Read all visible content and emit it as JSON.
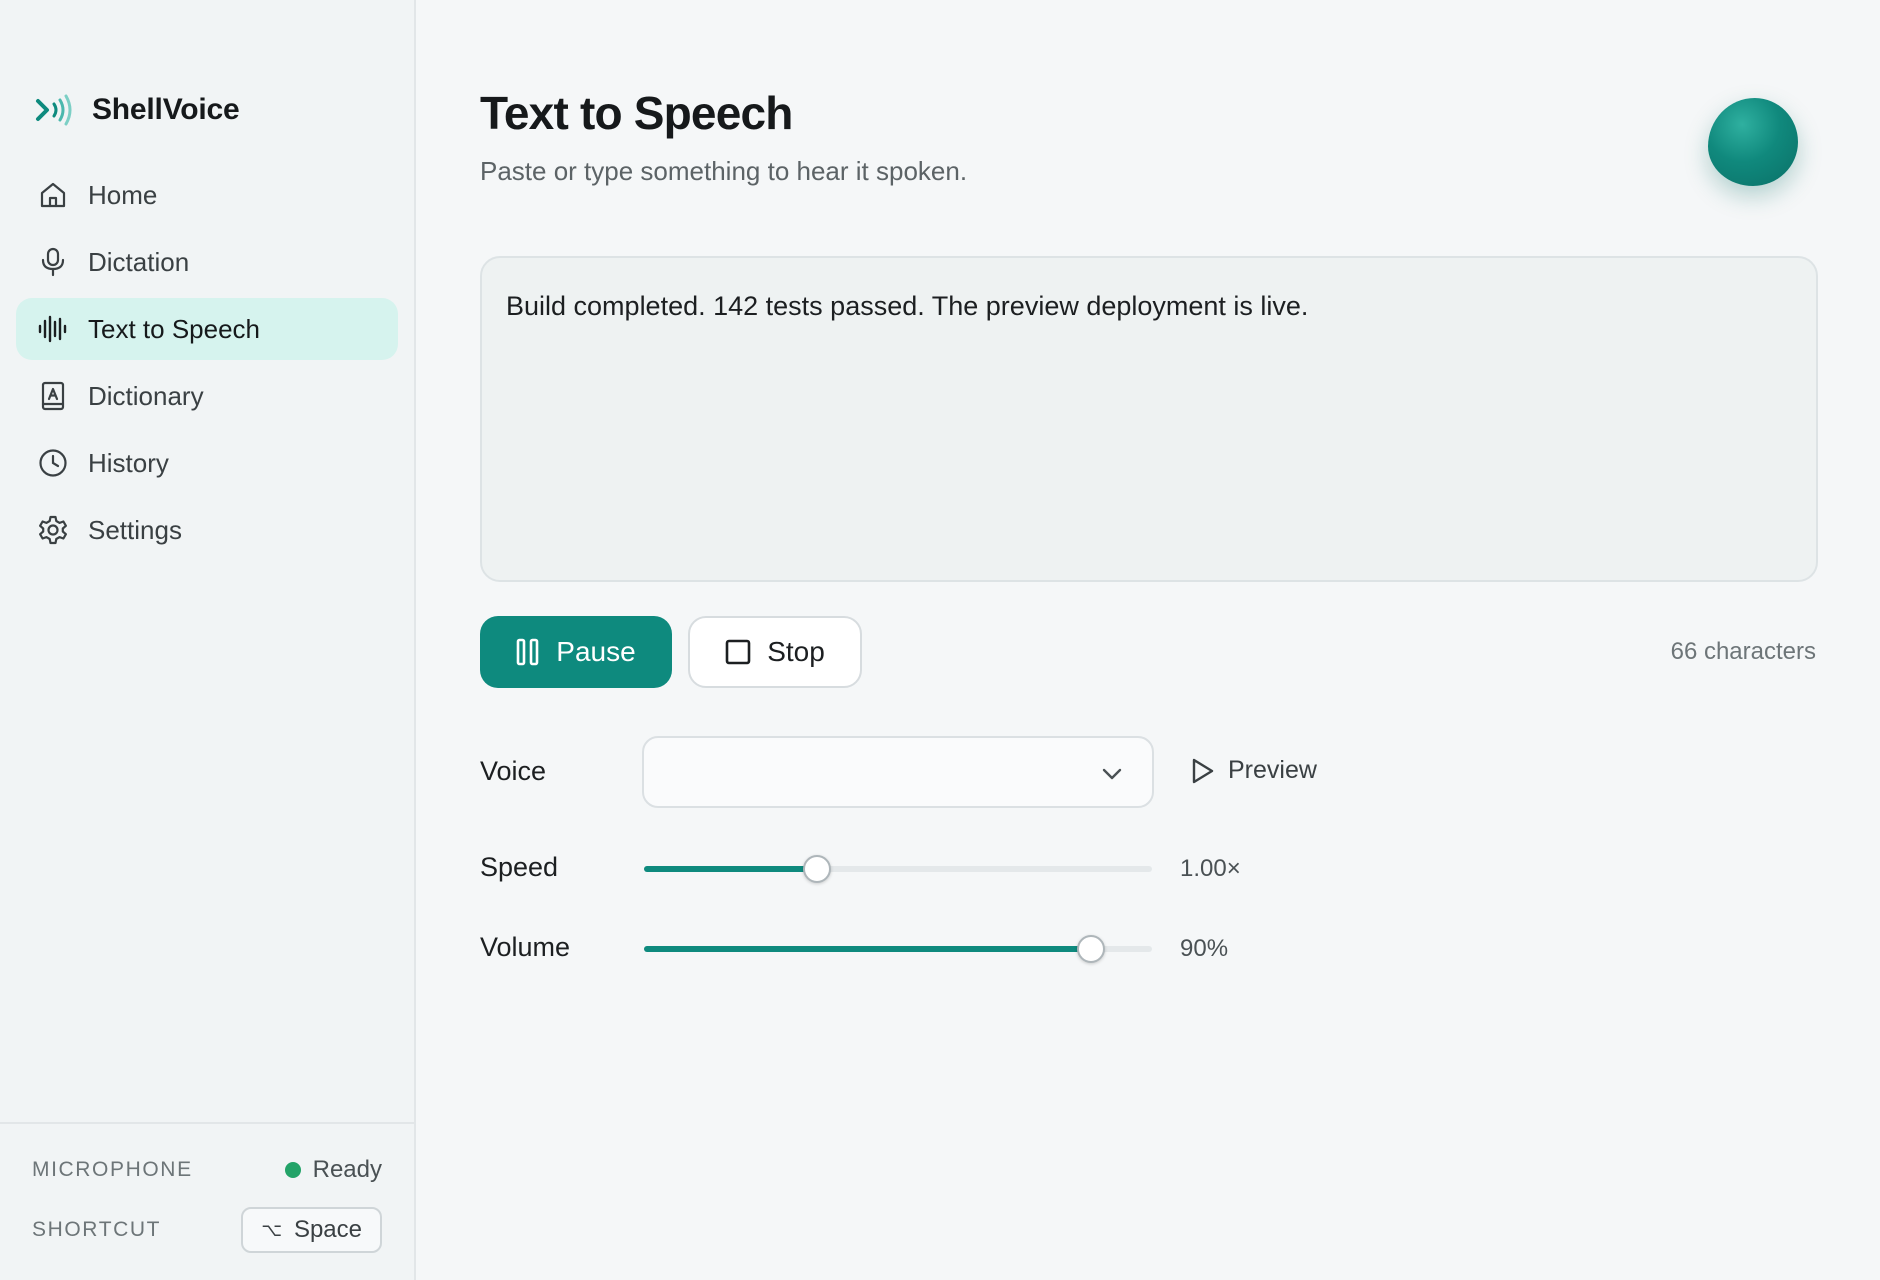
{
  "app": {
    "name": "ShellVoice"
  },
  "sidebar": {
    "items": [
      {
        "label": "Home",
        "icon": "home-icon",
        "active": false
      },
      {
        "label": "Dictation",
        "icon": "microphone-icon",
        "active": false
      },
      {
        "label": "Text to Speech",
        "icon": "waveform-icon",
        "active": true
      },
      {
        "label": "Dictionary",
        "icon": "book-icon",
        "active": false
      },
      {
        "label": "History",
        "icon": "clock-icon",
        "active": false
      },
      {
        "label": "Settings",
        "icon": "gear-icon",
        "active": false
      }
    ],
    "footer": {
      "microphone_label": "MICROPHONE",
      "microphone_status": "Ready",
      "shortcut_label": "SHORTCUT",
      "shortcut_modifier": "⌥",
      "shortcut_key": "Space"
    }
  },
  "main": {
    "title": "Text to Speech",
    "subtitle": "Paste or type something to hear it spoken.",
    "text": "Build completed. 142 tests passed. The preview deployment is live.",
    "pause_label": "Pause",
    "stop_label": "Stop",
    "char_count": "66 characters",
    "voice_label": "Voice",
    "voice_value": "",
    "preview_label": "Preview",
    "speed_label": "Speed",
    "speed_value": "1.00×",
    "speed_fraction": 0.34,
    "volume_label": "Volume",
    "volume_value": "90%",
    "volume_fraction": 0.88
  },
  "colors": {
    "accent": "#0e8a7e",
    "active_nav_bg": "#d6f3ee",
    "status_ready": "#23a368"
  }
}
